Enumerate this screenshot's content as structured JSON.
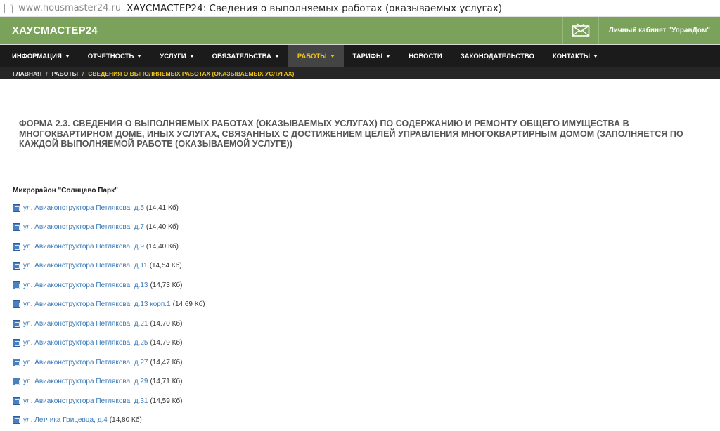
{
  "browser": {
    "url": "www.housmaster24.ru",
    "title": "ХАУСМАСТЕР24: Сведения о выполняемых работах (оказываемых услугах)"
  },
  "header": {
    "logo": "ХАУСМАСТЕР24",
    "cabinet_link": "Личный кабинет \"УправДом\""
  },
  "nav": {
    "items": [
      {
        "label": "ИНФОРМАЦИЯ",
        "dropdown": true
      },
      {
        "label": "ОТЧЕТНОСТЬ",
        "dropdown": true
      },
      {
        "label": "УСЛУГИ",
        "dropdown": true
      },
      {
        "label": "ОБЯЗАТЕЛЬСТВА",
        "dropdown": true
      },
      {
        "label": "РАБОТЫ",
        "dropdown": true,
        "active": true
      },
      {
        "label": "ТАРИФЫ",
        "dropdown": true
      },
      {
        "label": "НОВОСТИ",
        "dropdown": false
      },
      {
        "label": "ЗАКОНОДАТЕЛЬСТВО",
        "dropdown": false
      },
      {
        "label": "КОНТАКТЫ",
        "dropdown": true
      }
    ]
  },
  "breadcrumb": {
    "home": "ГЛАВНАЯ",
    "section": "РАБОТЫ",
    "current": "СВЕДЕНИЯ О ВЫПОЛНЯЕМЫХ РАБОТАХ (ОКАЗЫВАЕМЫХ УСЛУГАХ)",
    "separator": "/"
  },
  "main": {
    "form_title": "ФОРМА 2.3. СВЕДЕНИЯ О ВЫПОЛНЯЕМЫХ РАБОТАХ (ОКАЗЫВАЕМЫХ УСЛУГАХ) ПО СОДЕРЖАНИЮ И РЕМОНТУ ОБЩЕГО ИМУЩЕСТВА В МНОГОКВАРТИРНОМ ДОМЕ, ИНЫХ УСЛУГАХ, СВЯЗАННЫХ С ДОСТИЖЕНИЕМ ЦЕЛЕЙ УПРАВЛЕНИЯ МНОГОКВАРТИРНЫМ ДОМОМ (ЗАПОЛНЯЕТСЯ ПО КАЖДОЙ ВЫПОЛНЯЕМОЙ РАБОТЕ (ОКАЗЫВАЕМОЙ УСЛУГЕ))",
    "district": "Микрорайон \"Солнцево Парк\"",
    "files": [
      {
        "name": "ул. Авиаконструктора Петлякова, д.5",
        "size": "(14,41 Кб)"
      },
      {
        "name": "ул. Авиаконструктора Петлякова, д.7",
        "size": "(14,40 Кб)"
      },
      {
        "name": "ул. Авиаконструктора Петлякова, д.9",
        "size": "(14,40 Кб)"
      },
      {
        "name": "ул. Авиаконструктора Петлякова, д.11",
        "size": "(14,54 Кб)"
      },
      {
        "name": "ул. Авиаконструктора Петлякова, д.13",
        "size": "(14,73 Кб)"
      },
      {
        "name": "ул. Авиаконструктора Петлякова, д.13 корп.1",
        "size": "(14,69 Кб)"
      },
      {
        "name": "ул. Авиаконструктора Петлякова, д.21",
        "size": "(14,70 Кб)"
      },
      {
        "name": "ул. Авиаконструктора Петлякова, д.25",
        "size": "(14,79 Кб)"
      },
      {
        "name": "ул. Авиаконструктора Петлякова, д.27",
        "size": "(14,47 Кб)"
      },
      {
        "name": "ул. Авиаконструктора Петлякова, д.29",
        "size": "(14,71 Кб)"
      },
      {
        "name": "ул. Авиаконструктора Петлякова, д.31",
        "size": "(14,59 Кб)"
      },
      {
        "name": "ул. Летчика Грицевца, д.4",
        "size": "(14,80 Кб)"
      }
    ]
  },
  "colors": {
    "header_green": "#7ba25b",
    "nav_dark": "#1b1b1b",
    "active_accent": "#f0c419",
    "link_blue": "#3d7bb8"
  },
  "icons": {
    "mail": "envelope-icon",
    "file": "spreadsheet-file-icon",
    "browser_page": "page-icon"
  }
}
